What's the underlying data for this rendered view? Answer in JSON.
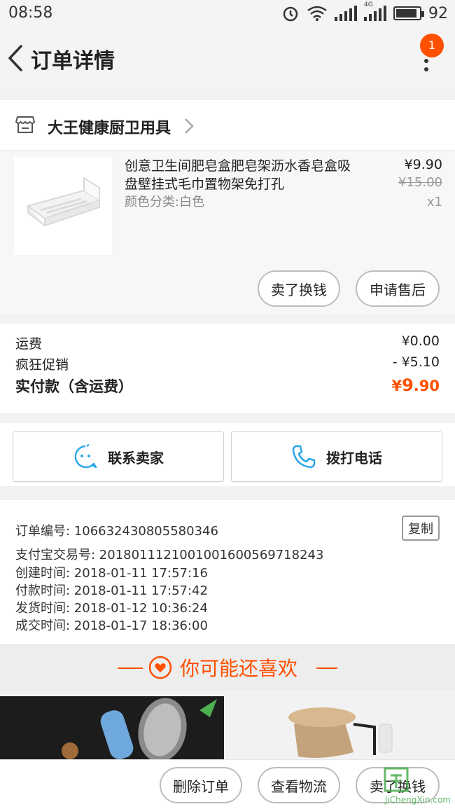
{
  "status_bar": {
    "time": "08:58",
    "battery": "92",
    "battery_level": 0.92,
    "network": "4G",
    "icons": [
      "alarm-icon",
      "wifi-icon",
      "signal-icon",
      "battery-icon"
    ]
  },
  "nav": {
    "title": "订单详情",
    "notification_count": "1",
    "back_icon": "chevron-left-icon",
    "more_icon": "more-vertical-icon"
  },
  "shop": {
    "name": "大王健康厨卫用具",
    "icon": "store-icon"
  },
  "product": {
    "title": "创意卫生间肥皂盒肥皂架沥水香皂盒吸盘壁挂式毛巾置物架免打孔",
    "sku": "颜色分类:白色",
    "price": "¥9.90",
    "original_price": "¥15.00",
    "quantity": "x1",
    "actions": [
      "卖了换钱",
      "申请售后"
    ]
  },
  "fees": {
    "shipping_label": "运费",
    "shipping_value": "¥0.00",
    "promo_label": "疯狂促销",
    "promo_value": "- ¥5.10",
    "total_label": "实付款（含运费）",
    "total_currency": "¥",
    "total_int": "9",
    "total_dec": ".90"
  },
  "contact": {
    "seller_label": "联系卖家",
    "phone_label": "拨打电话"
  },
  "order_info": {
    "order_no": "订单编号: 106632430805580346",
    "alipay_no": "支付宝交易号: 2018011121001001600569718243",
    "created": "创建时间: 2018-01-11 17:57:16",
    "paid": "付款时间: 2018-01-11 17:57:42",
    "shipped": "发货时间: 2018-01-12 10:36:24",
    "completed": "成交时间: 2018-01-17 18:36:00",
    "copy_label": "复制"
  },
  "recommend": {
    "title": "你可能还喜欢"
  },
  "bottom_actions": {
    "delete": "删除订单",
    "logistics": "查看物流",
    "sell": "卖了换钱"
  },
  "watermark": {
    "text": "JiChengXin.com"
  },
  "colors": {
    "accent": "#ff5000",
    "background": "#f2f2f2"
  }
}
